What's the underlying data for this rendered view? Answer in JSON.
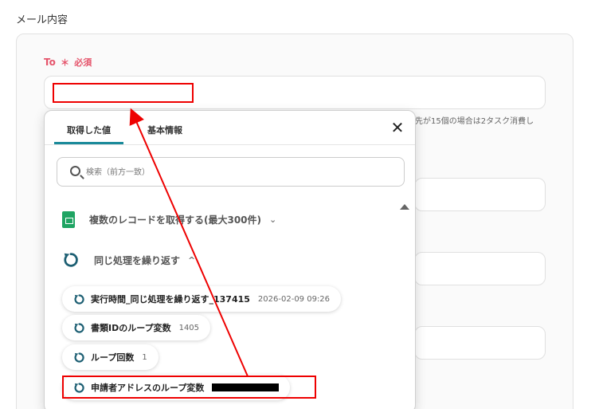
{
  "section_title": "メール内容",
  "to_field": {
    "label": "To",
    "required_mark": "＊",
    "required_text": "必須",
    "value": ""
  },
  "hint_text": "先が15個の場合は2タスク消費し",
  "popup": {
    "tabs": [
      {
        "label": "取得した値",
        "active": true
      },
      {
        "label": "基本情報",
        "active": false
      }
    ],
    "close_symbol": "✕",
    "search_placeholder": "検索（前方一致）",
    "groups": [
      {
        "label": "複数のレコードを取得する(最大300件)",
        "icon": "google-sheets-icon",
        "chevron": "⌄"
      },
      {
        "label": "同じ処理を繰り返す",
        "icon": "loop-icon",
        "chevron": "^"
      }
    ],
    "chips": [
      {
        "label": "実行時間_同じ処理を繰り返す_137415",
        "value": "2026-02-09 09:26"
      },
      {
        "label": "書類IDのループ変数",
        "value": "1405"
      },
      {
        "label": "ループ回数",
        "value": "1"
      },
      {
        "label": "申請者アドレスのループ変数",
        "value": ""
      }
    ]
  },
  "colors": {
    "accent": "#1a8a9a",
    "required": "#e5546b",
    "highlight": "#ee0000",
    "loop_icon": "#1d5f73"
  }
}
